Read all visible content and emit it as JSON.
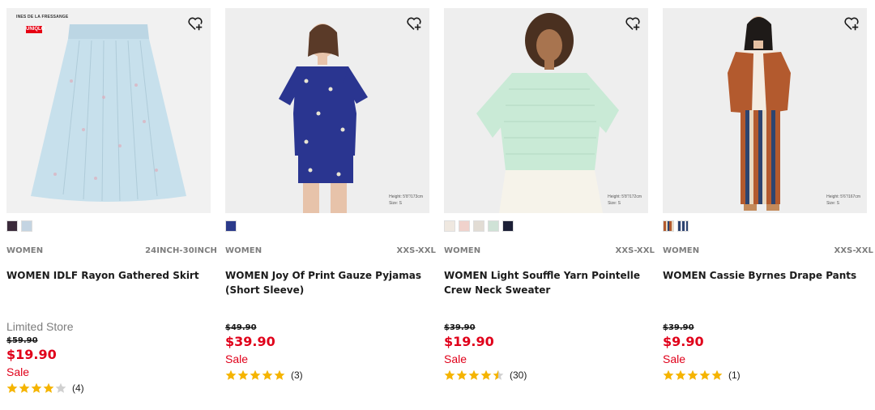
{
  "products": [
    {
      "photo_badge": "INES DE LA FRESSANGE",
      "photo_badge_sub": "PARIS",
      "logo_text": "UNIQLO",
      "photo_note": "",
      "swatches": [
        "#3a2a3a",
        "#c4d4e2"
      ],
      "gender": "WOMEN",
      "size_range": "24INCH-30INCH",
      "name": "WOMEN IDLF Rayon Gathered Skirt",
      "store_note": "Limited Store",
      "original_price": "$59.90",
      "price": "$19.90",
      "sale_label": "Sale",
      "rating": 4,
      "review_count": "(4)"
    },
    {
      "photo_badge": "",
      "photo_badge_sub": "",
      "logo_text": "",
      "photo_note": "Height: 5'8\"/173cm\nSize: S",
      "swatches": [
        "#2b3a8a"
      ],
      "gender": "WOMEN",
      "size_range": "XXS-XXL",
      "name": "WOMEN Joy Of Print Gauze Pyjamas (Short Sleeve)",
      "store_note": "",
      "original_price": "$49.90",
      "price": "$39.90",
      "sale_label": "Sale",
      "rating": 5,
      "review_count": "(3)"
    },
    {
      "photo_badge": "",
      "photo_badge_sub": "",
      "logo_text": "",
      "photo_note": "Height: 5'8\"/172cm\nSize: S",
      "swatches": [
        "#efe8e0",
        "#f0d2cc",
        "#e2dcd4",
        "#cfe2d6",
        "#1c1f36"
      ],
      "gender": "WOMEN",
      "size_range": "XXS-XXL",
      "name": "WOMEN Light Souffle Yarn Pointelle Crew Neck Sweater",
      "store_note": "",
      "original_price": "$39.90",
      "price": "$19.90",
      "sale_label": "Sale",
      "rating": 4.5,
      "review_count": "(30)"
    },
    {
      "photo_badge": "",
      "photo_badge_sub": "",
      "logo_text": "",
      "photo_note": "Height: 5'6\"/167cm\nSize: S",
      "swatches": [
        "#b35a2e",
        "#2d4470"
      ],
      "gender": "WOMEN",
      "size_range": "XXS-XXL",
      "name": "WOMEN Cassie Byrnes Drape Pants",
      "store_note": "",
      "original_price": "$39.90",
      "price": "$9.90",
      "sale_label": "Sale",
      "rating": 5,
      "review_count": "(1)"
    }
  ],
  "colors": {
    "sale_red": "#e0001a",
    "star_gold": "#f5b400",
    "muted_gray": "#7d7d7d"
  },
  "icons": {
    "favorite": "heart-plus-icon",
    "star": "star-icon"
  }
}
